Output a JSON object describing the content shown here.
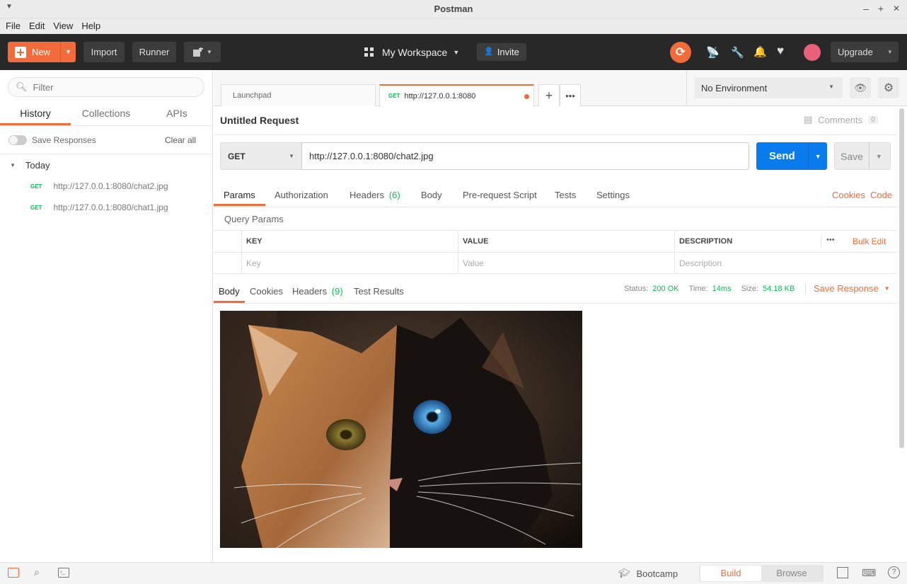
{
  "window": {
    "title": "Postman",
    "min": "–",
    "max": "+",
    "close": "✕"
  },
  "menu": [
    "File",
    "Edit",
    "View",
    "Help"
  ],
  "header": {
    "new_label": "New",
    "import_label": "Import",
    "runner_label": "Runner",
    "workspace_label": "My Workspace",
    "invite_label": "Invite",
    "upgrade_label": "Upgrade"
  },
  "sidebar": {
    "filter_placeholder": "Filter",
    "tabs": [
      "History",
      "Collections",
      "APIs"
    ],
    "save_responses_label": "Save Responses",
    "clear_all_label": "Clear all",
    "group_label": "Today",
    "history": [
      {
        "method": "GET",
        "url": "http://127.0.0.1:8080/chat2.jpg"
      },
      {
        "method": "GET",
        "url": "http://127.0.0.1:8080/chat1.jpg"
      }
    ]
  },
  "tabs": {
    "launchpad": "Launchpad",
    "active_method": "GET",
    "active_url": "http://127.0.0.1:8080"
  },
  "environment": {
    "selected": "No Environment"
  },
  "request": {
    "title": "Untitled Request",
    "comments_label": "Comments",
    "comments_count": "0",
    "method": "GET",
    "url": "http://127.0.0.1:8080/chat2.jpg",
    "send_label": "Send",
    "save_label": "Save",
    "param_tabs": {
      "params": "Params",
      "authorization": "Authorization",
      "headers": "Headers",
      "headers_count": "(6)",
      "body": "Body",
      "prerequest": "Pre-request Script",
      "tests": "Tests",
      "settings": "Settings"
    },
    "cookies_link": "Cookies",
    "code_link": "Code",
    "query_params_label": "Query Params",
    "columns": [
      "KEY",
      "VALUE",
      "DESCRIPTION"
    ],
    "bulk_edit_label": "Bulk Edit",
    "placeholders": {
      "key": "Key",
      "value": "Value",
      "description": "Description"
    }
  },
  "response": {
    "tabs": {
      "body": "Body",
      "cookies": "Cookies",
      "headers": "Headers",
      "headers_count": "(9)",
      "test_results": "Test Results"
    },
    "status_label": "Status:",
    "status_value": "200 OK",
    "time_label": "Time:",
    "time_value": "14ms",
    "size_label": "Size:",
    "size_value": "54.18 KB",
    "save_response_label": "Save Response"
  },
  "footer": {
    "bootcamp_label": "Bootcamp",
    "build_label": "Build",
    "browse_label": "Browse"
  },
  "colors": {
    "accent": "#f26b3a",
    "send_blue": "#097bed",
    "success_green": "#0cbb52",
    "header_dark": "#282828"
  }
}
